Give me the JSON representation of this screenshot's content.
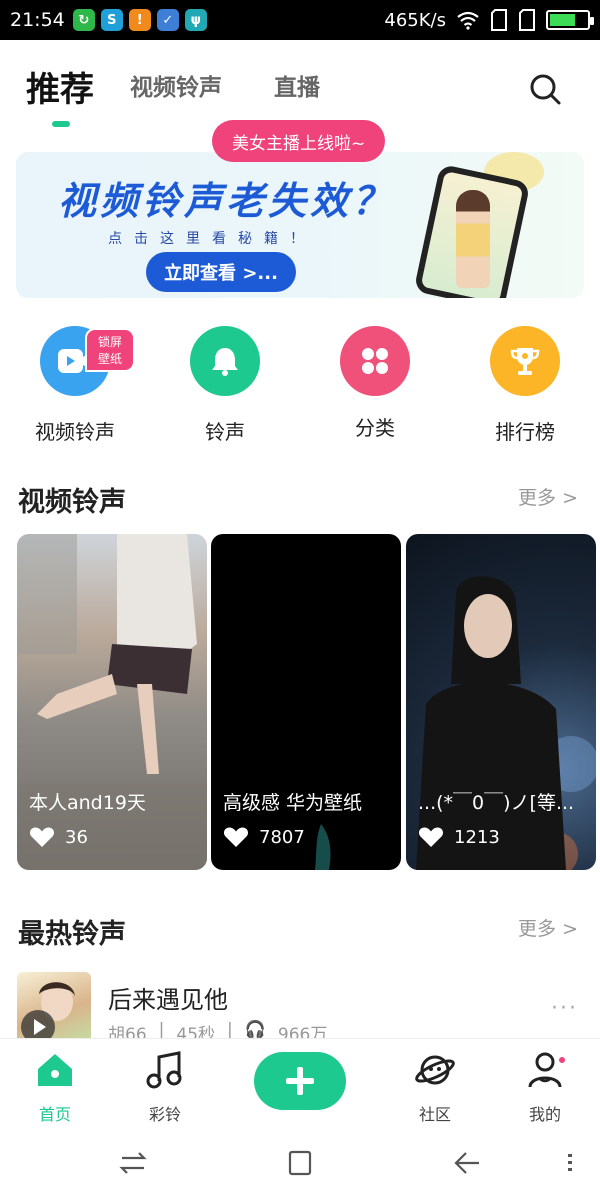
{
  "status_bar": {
    "time": "21:54",
    "net_speed": "465K/s",
    "battery_level": 0.7
  },
  "header": {
    "tabs": [
      {
        "label": "推荐",
        "active": true
      },
      {
        "label": "视频铃声",
        "active": false
      },
      {
        "label": "直播",
        "active": false
      }
    ],
    "accent_color": "#1ec98f"
  },
  "banner": {
    "badge": "美女主播上线啦~",
    "title": "视频铃声老失效？",
    "subtitle": "点击这里看秘籍！",
    "button": "立即查看 >..."
  },
  "quick_entries": [
    {
      "label": "视频铃声",
      "icon": "video-play-icon",
      "color": "#3aa3f0",
      "badge": "锁屏壁纸"
    },
    {
      "label": "铃声",
      "icon": "bell-icon",
      "color": "#1ec98f"
    },
    {
      "label": "分类",
      "icon": "grid-icon",
      "color": "#f0517a"
    },
    {
      "label": "排行榜",
      "icon": "trophy-icon",
      "color": "#fbb526"
    }
  ],
  "video_section": {
    "title": "视频铃声",
    "more": "更多 >",
    "cards": [
      {
        "title": "本人and19天",
        "likes": "36"
      },
      {
        "title": "高级感 华为壁纸",
        "likes": "7807"
      },
      {
        "title": "...(*￣0￣)ノ[等...",
        "likes": "1213"
      }
    ]
  },
  "hot_section": {
    "title": "最热铃声",
    "more": "更多 >",
    "items": [
      {
        "title": "后来遇见他",
        "artist": "胡66",
        "duration": "45秒",
        "plays": "966万"
      }
    ]
  },
  "bottom_nav": {
    "items": [
      {
        "label": "首页",
        "icon": "home-icon",
        "active": true
      },
      {
        "label": "彩铃",
        "icon": "music-note-icon",
        "active": false
      },
      {
        "label": "社区",
        "icon": "planet-icon",
        "active": false
      },
      {
        "label": "我的",
        "icon": "profile-icon",
        "active": false
      }
    ]
  }
}
